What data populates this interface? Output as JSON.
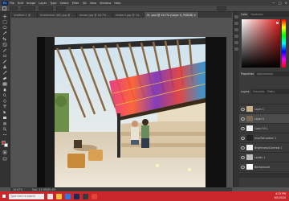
{
  "app": {
    "logo": "Ps"
  },
  "menu": [
    "File",
    "Edit",
    "Image",
    "Layer",
    "Type",
    "Select",
    "Filter",
    "3D",
    "View",
    "Window",
    "Help"
  ],
  "window_controls": {
    "min": "—",
    "max": "□",
    "close": "✕"
  },
  "tabs": [
    {
      "label": "Untitled-1 @ ..."
    },
    {
      "label": "Screenshot (60).jpg @ ..."
    },
    {
      "label": "render.jpg @ 16.7% ..."
    },
    {
      "label": "render2.jpg @ 16..."
    },
    {
      "label": "lit .psd @ 16.7% (Layer 0, RGB/8) ✕",
      "active": true
    }
  ],
  "status": {
    "zoom": "16.67%",
    "doc_info": "Doc: 24.9M/80.4M"
  },
  "panels": {
    "top_tabs": [
      "Color",
      "Swatches"
    ],
    "mid_tabs": [
      "Properties",
      "Adjustments"
    ],
    "layer_tabs": [
      "Layers",
      "Channels",
      "Paths"
    ],
    "layers": [
      {
        "name": "Layer 1",
        "selected": false
      },
      {
        "name": "Layer 0",
        "selected": true
      },
      {
        "name": "Color Fill 1",
        "selected": false
      },
      {
        "name": "Hue/Saturation 1",
        "selected": false
      },
      {
        "name": "Brightness/Contrast 1",
        "selected": false
      },
      {
        "name": "Levels 1",
        "selected": false
      },
      {
        "name": "Background",
        "selected": false
      }
    ]
  },
  "taskbar": {
    "search_placeholder": "Type here to search",
    "time": "4:25 PM",
    "date": "6/1/2020"
  },
  "colors": {
    "taskbar": "#c9272c",
    "chrome_dark": "#323232",
    "chrome_mid": "#535353",
    "foreground_swatch": "#c8322a",
    "background_swatch": "#ffffff"
  }
}
